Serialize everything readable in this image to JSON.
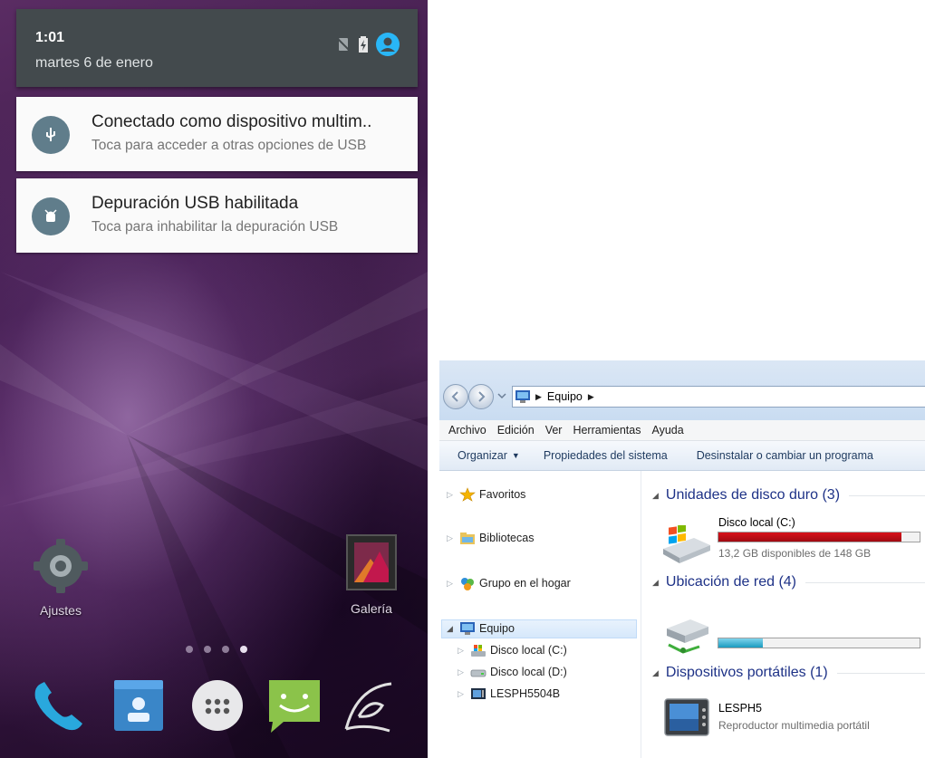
{
  "android": {
    "status": {
      "time": "1:01",
      "date": "martes 6 de enero"
    },
    "notifications": [
      {
        "title": "Conectado como dispositivo multim..",
        "subtitle": "Toca para acceder a otras opciones de USB",
        "icon": "usb-icon"
      },
      {
        "title": "Depuración USB habilitada",
        "subtitle": "Toca para inhabilitar la depuración USB",
        "icon": "android-debug-icon"
      }
    ],
    "home": {
      "settings_label": "Ajustes",
      "gallery_label": "Galería"
    },
    "dock": [
      "phone-icon",
      "contacts-icon",
      "apps-icon",
      "messaging-icon",
      "browser-icon"
    ]
  },
  "explorer": {
    "breadcrumb": "Equipo",
    "menu": [
      "Archivo",
      "Edición",
      "Ver",
      "Herramientas",
      "Ayuda"
    ],
    "toolbar": {
      "organize": "Organizar",
      "system_properties": "Propiedades del sistema",
      "uninstall": "Desinstalar o cambiar un programa"
    },
    "nav": {
      "favorites": "Favoritos",
      "libraries": "Bibliotecas",
      "homegroup": "Grupo en el hogar",
      "computer": "Equipo",
      "children": [
        "Disco local (C:)",
        "Disco local (D:)",
        "LESPH5504B"
      ]
    },
    "groups": {
      "hard_disks": "Unidades de disco duro (3)",
      "network": "Ubicación de red (4)",
      "portable": "Dispositivos portátiles (1)"
    },
    "drive_c": {
      "name": "Disco local (C:)",
      "free": "13,2 GB disponibles de 148 GB",
      "used_fraction": 0.91,
      "bar_color": "#d9111a"
    },
    "network_drive": {
      "used_fraction": 0.22,
      "bar_color": "#1a9bbf"
    },
    "device": {
      "name": "LESPH5",
      "type": "Reproductor multimedia portátil"
    }
  }
}
